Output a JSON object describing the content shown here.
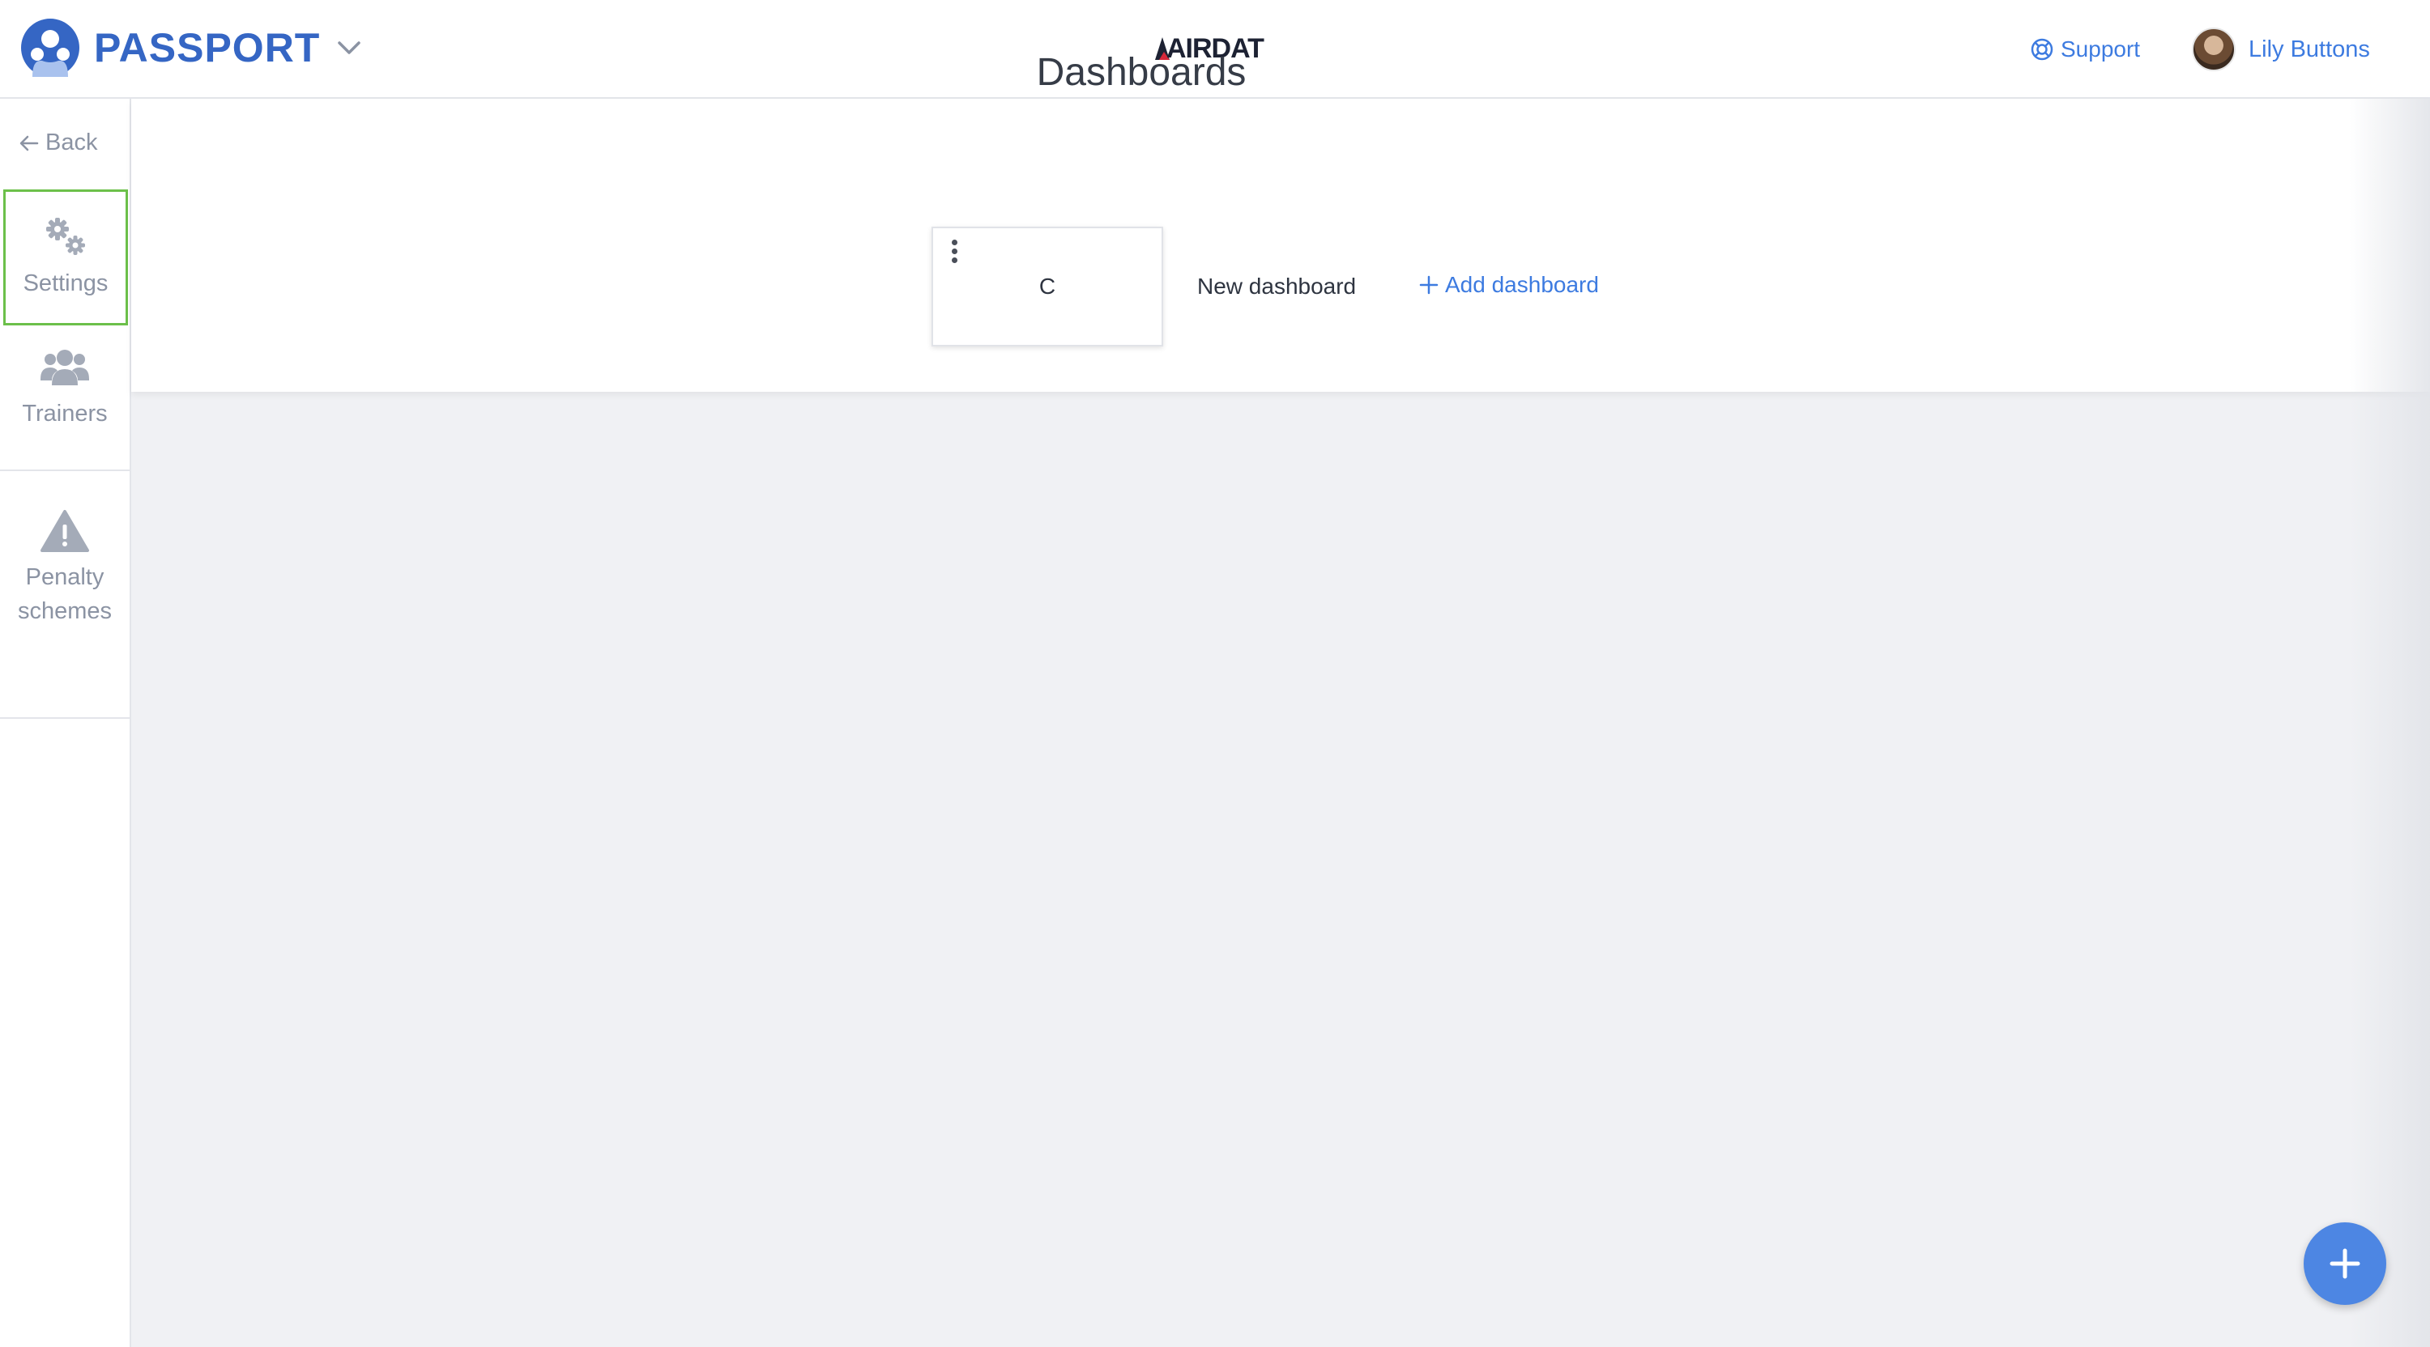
{
  "header": {
    "brand_name": "PASSPORT",
    "center_logo": "AIRDAT",
    "support_label": "Support",
    "user_name": "Lily Buttons"
  },
  "sidebar": {
    "back_label": "Back",
    "items": [
      {
        "label": "Settings",
        "icon": "gears-icon"
      },
      {
        "label": "Trainers",
        "icon": "users-icon"
      },
      {
        "label": "Penalty schemes",
        "icon": "warning-icon"
      }
    ]
  },
  "main": {
    "title": "Dashboards",
    "dashboard_card": {
      "letter": "C"
    },
    "new_dashboard_label": "New dashboard",
    "add_dashboard_label": "Add dashboard"
  },
  "colors": {
    "brand": "#3566c4",
    "link": "#3d7be0",
    "fab": "#4d86e3",
    "selected_border": "#6cc04a",
    "background": "#f0f1f4"
  }
}
